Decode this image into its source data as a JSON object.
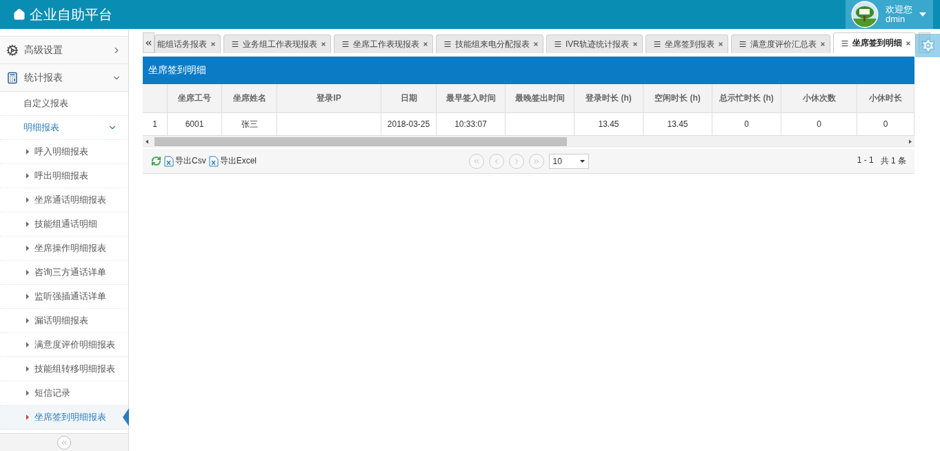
{
  "header": {
    "title": "企业自助平台",
    "user": {
      "greeting": "欢迎您",
      "name": "dmin"
    }
  },
  "sidebar": {
    "items": [
      {
        "label": "高级设置",
        "expanded": false
      },
      {
        "label": "统计报表",
        "expanded": true,
        "children": [
          {
            "label": "自定义报表",
            "selected": false
          },
          {
            "label": "明细报表",
            "selected": false,
            "expanded": true,
            "children": [
              {
                "label": "呼入明细报表",
                "selected": false
              },
              {
                "label": "呼出明细报表",
                "selected": false
              },
              {
                "label": "坐席通话明细报表",
                "selected": false
              },
              {
                "label": "技能组通话明细",
                "selected": false
              },
              {
                "label": "坐席操作明细报表",
                "selected": false
              },
              {
                "label": "咨询三方通话详单",
                "selected": false
              },
              {
                "label": "监听强插通话详单",
                "selected": false
              },
              {
                "label": "漏话明细报表",
                "selected": false
              },
              {
                "label": "满意度评价明细报表",
                "selected": false
              },
              {
                "label": "技能组转移明细报表",
                "selected": false
              },
              {
                "label": "短信记录",
                "selected": false
              },
              {
                "label": "坐席签到明细报表",
                "selected": true
              }
            ]
          }
        ]
      }
    ]
  },
  "tabs": [
    {
      "label": "能组话务报表",
      "menu_icon": false,
      "selected": false
    },
    {
      "label": "业务组工作表现报表",
      "menu_icon": true,
      "selected": false
    },
    {
      "label": "坐席工作表现报表",
      "menu_icon": true,
      "selected": false
    },
    {
      "label": "技能组来电分配报表",
      "menu_icon": true,
      "selected": false
    },
    {
      "label": "IVR轨迹统计报表",
      "menu_icon": true,
      "selected": false
    },
    {
      "label": "坐席签到报表",
      "menu_icon": true,
      "selected": false
    },
    {
      "label": "满意度评价汇总表",
      "menu_icon": true,
      "selected": false
    },
    {
      "label": "坐席签到明细",
      "menu_icon": true,
      "selected": true
    }
  ],
  "panel": {
    "title": "坐席签到明细"
  },
  "table": {
    "columns": [
      "",
      "坐席工号",
      "坐席姓名",
      "登录IP",
      "日期",
      "最早签入时间",
      "最晚签出时间",
      "登录时长 (h)",
      "空闲时长 (h)",
      "总示忙时长 (h)",
      "小休次数",
      "小休时长"
    ],
    "rows": [
      [
        "1",
        "6001",
        "张三",
        "",
        "2018-03-25",
        "10:33:07",
        "",
        "13.45",
        "13.45",
        "0",
        "0",
        "0"
      ]
    ]
  },
  "toolbar": {
    "export_csv": "导出Csv",
    "export_excel": "导出Excel",
    "page_size": "10",
    "range": "1 - 1",
    "total": "共 1 条"
  }
}
